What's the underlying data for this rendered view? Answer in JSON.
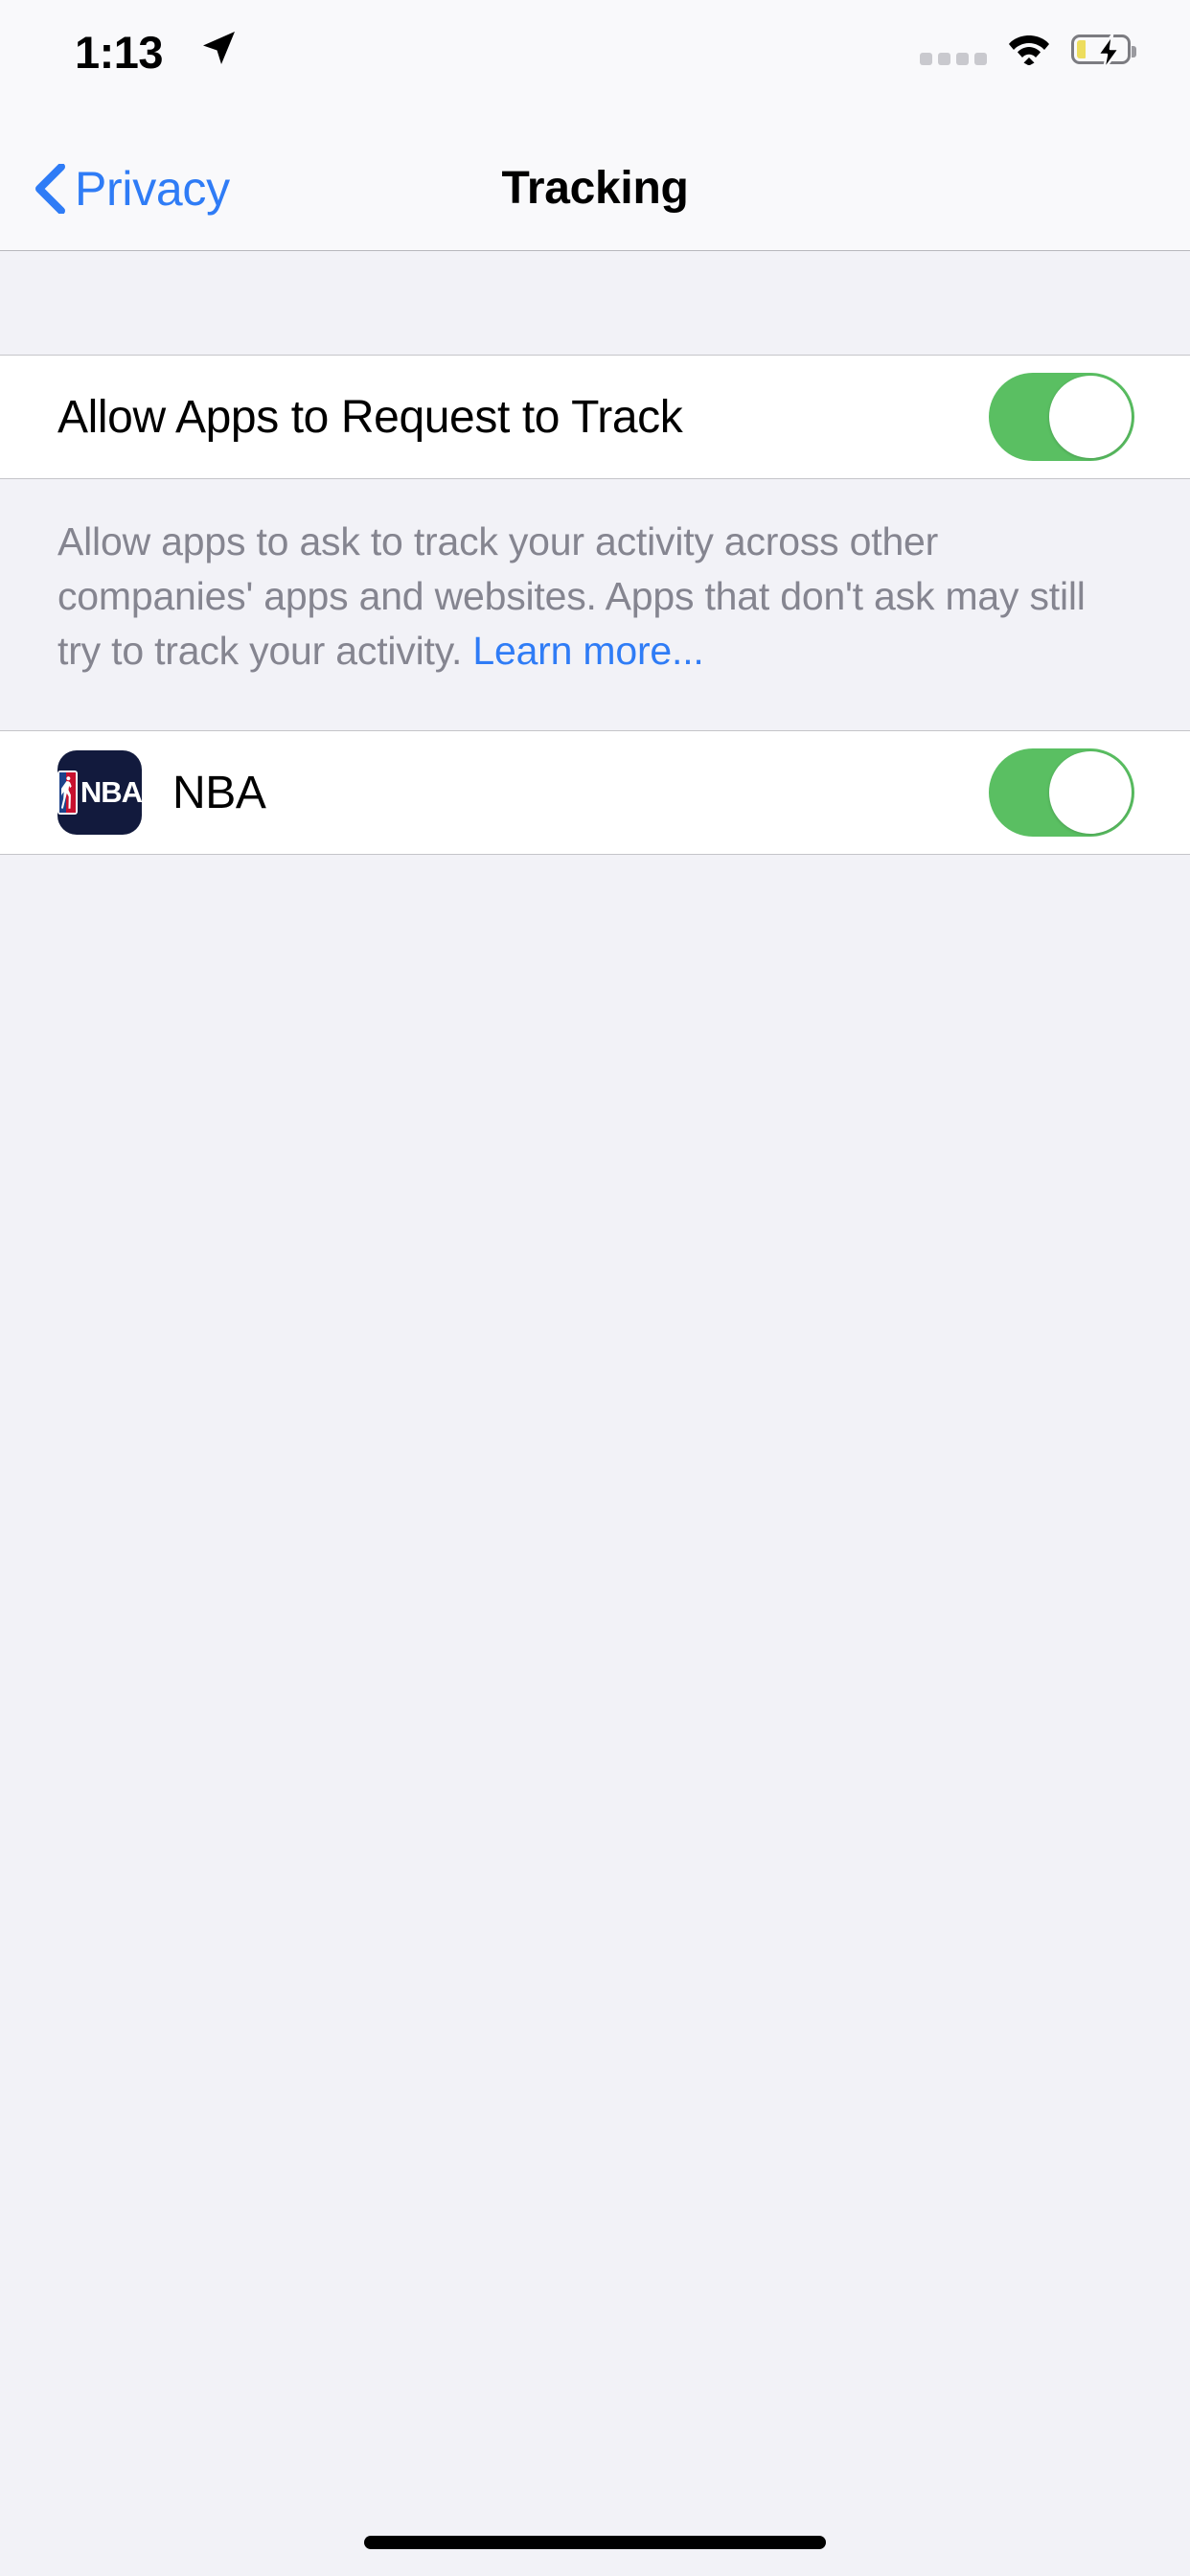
{
  "status_bar": {
    "time": "1:13",
    "location_icon": "location-arrow-icon",
    "signal_icon": "cellular-signal-dots-icon",
    "wifi_icon": "wifi-icon",
    "battery_icon": "battery-charging-icon",
    "battery_state": "charging-low",
    "battery_fill_color": "#EDDD5E"
  },
  "nav": {
    "back_label": "Privacy",
    "back_icon": "chevron-left-icon",
    "title": "Tracking",
    "accent_color": "#2F7CF6"
  },
  "sections": [
    {
      "rows": [
        {
          "label": "Allow Apps to Request to Track",
          "control": "toggle",
          "value": "on"
        }
      ],
      "footer": {
        "text": "Allow apps to ask to track your activity across other companies' apps and websites. Apps that don't ask may still try to track your activity. ",
        "link_text": "Learn more..."
      }
    },
    {
      "rows": [
        {
          "label": "NBA",
          "icon": "nba-app-icon",
          "icon_word": "NBA",
          "control": "toggle",
          "value": "on"
        }
      ]
    }
  ],
  "colors": {
    "toggle_on": "#5ABF62",
    "grouped_background": "#F2F2F7",
    "cell_background": "#FFFFFF",
    "footer_text": "#858590",
    "link": "#2F7CF6"
  },
  "home_indicator": "home-indicator"
}
